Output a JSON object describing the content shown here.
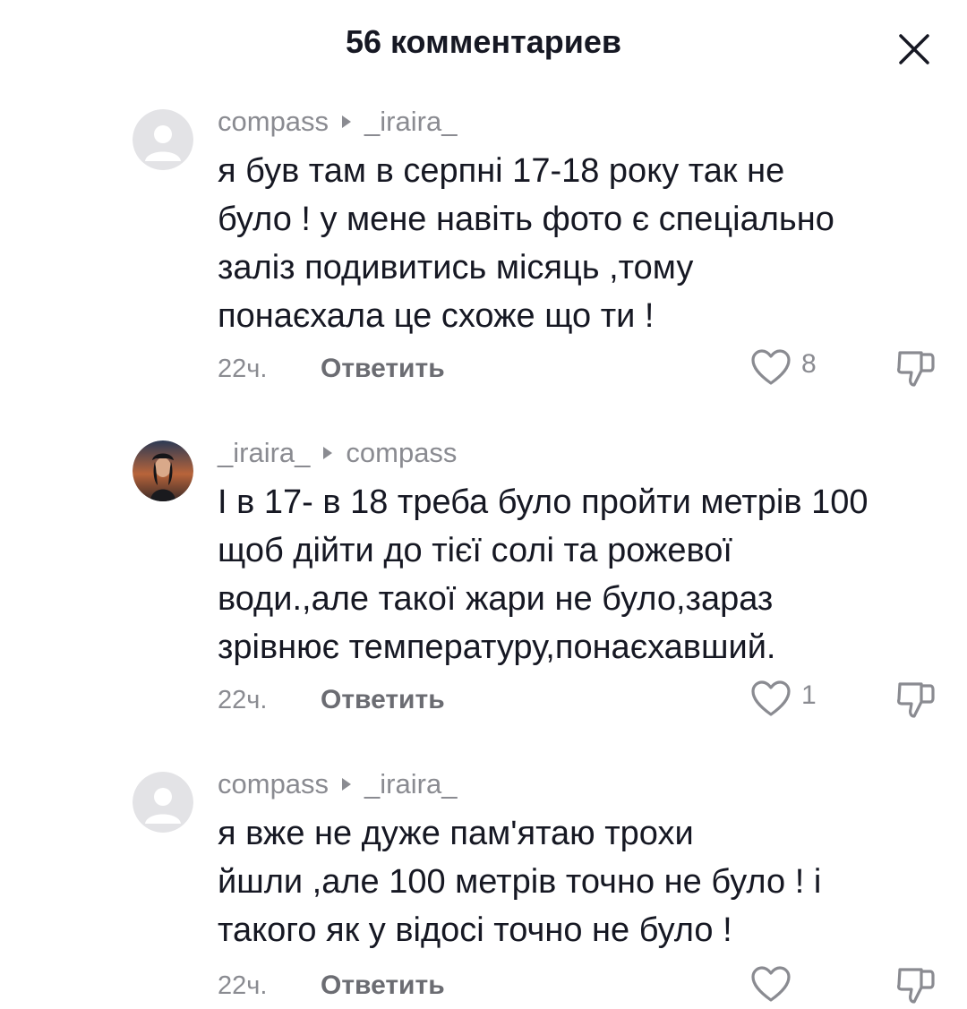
{
  "header": {
    "title": "56 комментариев",
    "close_icon": "close-icon"
  },
  "comments": [
    {
      "author": "compass",
      "reply_to": "_iraira_",
      "text_lines": [
        "я був там в серпні 17-18 року так не",
        "було ! у мене навіть фото є спеціально",
        "заліз подивитись місяць ,тому",
        "понаєхала це схоже що ти !"
      ],
      "time": "22ч.",
      "reply_label": "Ответить",
      "likes": "8",
      "avatar": "default-avatar"
    },
    {
      "author": "_iraira_",
      "reply_to": "compass",
      "text_lines": [
        "І в 17- в 18 треба було пройти метрів 100",
        "щоб дійти до тієї солі та рожевої",
        "води.,але такої жари не було,зараз",
        "зрівнює температуру,понаєхавший."
      ],
      "time": "22ч.",
      "reply_label": "Ответить",
      "likes": "1",
      "avatar": "photo-avatar"
    },
    {
      "author": "compass",
      "reply_to": "_iraira_",
      "text_lines": [
        "я вже не дуже пам'ятаю трохи",
        "йшли ,але 100 метрів точно не було ! і",
        "такого як у відосі точно не було !"
      ],
      "time": "22ч.",
      "reply_label": "Ответить",
      "likes": "",
      "avatar": "default-avatar"
    }
  ],
  "colors": {
    "text": "#161823",
    "muted": "#8a8b91",
    "avatar_bg": "#e3e3e6"
  }
}
